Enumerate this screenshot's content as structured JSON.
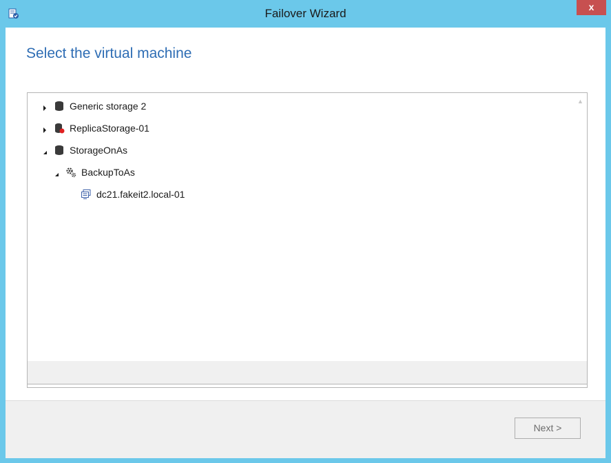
{
  "window": {
    "title": "Failover Wizard",
    "close_label": "x",
    "title_icon": "wizard-app-icon"
  },
  "page": {
    "heading": "Select the virtual machine"
  },
  "tree": {
    "items": [
      {
        "label": "Generic storage 2",
        "expanded": false,
        "icon": "storage-icon",
        "level": 0
      },
      {
        "label": "ReplicaStorage-01",
        "expanded": false,
        "icon": "storage-error-icon",
        "level": 0
      },
      {
        "label": "StorageOnAs",
        "expanded": true,
        "icon": "storage-icon",
        "level": 0
      },
      {
        "label": "BackupToAs",
        "expanded": true,
        "icon": "job-gears-icon",
        "level": 1
      },
      {
        "label": "dc21.fakeit2.local-01",
        "expanded": null,
        "icon": "virtual-machine-icon",
        "level": 2
      }
    ]
  },
  "footer": {
    "next_label": "Next >"
  },
  "colors": {
    "titlebar": "#6bc8ea",
    "heading": "#2e6db4",
    "close": "#c75050",
    "error_dot": "#e02020"
  }
}
